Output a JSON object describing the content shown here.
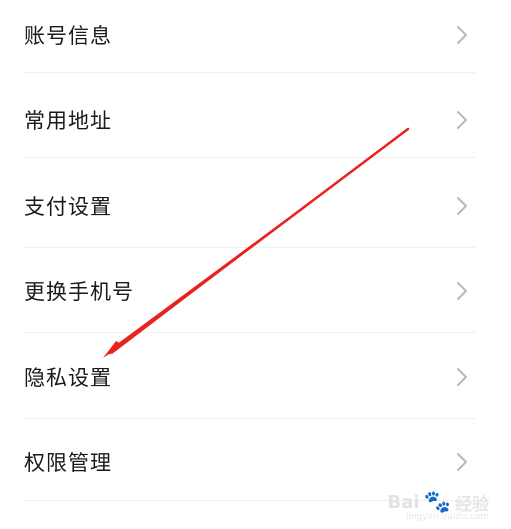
{
  "menu": {
    "items": [
      {
        "label": "账号信息"
      },
      {
        "label": "常用地址"
      },
      {
        "label": "支付设置"
      },
      {
        "label": "更换手机号"
      },
      {
        "label": "隐私设置"
      },
      {
        "label": "权限管理"
      }
    ]
  },
  "colors": {
    "text": "#1a1a1a",
    "chevron": "#b9b9b9",
    "divider": "#efefef",
    "annotation_arrow": "#e8231f"
  },
  "icons": {
    "chevron": "chevron-right-icon",
    "watermark": "paw-icon"
  },
  "watermark": {
    "brand": "Bai",
    "suffix": "经验",
    "url": "jingyan.baidu.com"
  }
}
